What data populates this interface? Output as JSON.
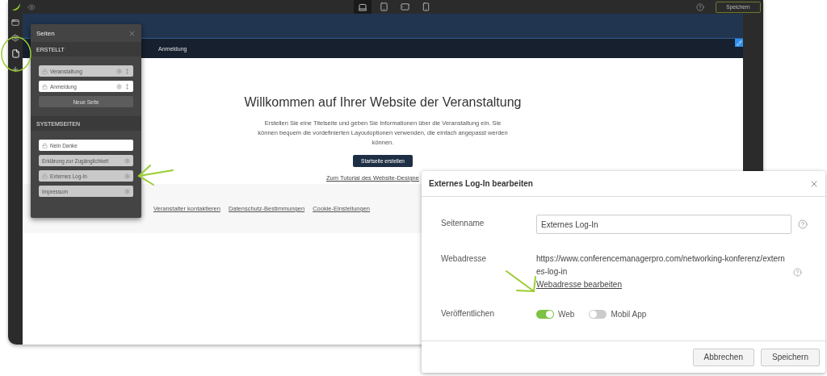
{
  "top_bar": {
    "devices": [
      {
        "kind": "laptop",
        "selected": true
      },
      {
        "kind": "tablet",
        "selected": false
      },
      {
        "kind": "tablet-landscape",
        "selected": false
      },
      {
        "kind": "phone",
        "selected": false
      }
    ],
    "save_button": "Speichern"
  },
  "site_nav": {
    "items": [
      "Anmeldung"
    ]
  },
  "welcome": {
    "title": "Willkommen auf Ihrer Website der Veranstaltung",
    "text": "Erstellen Sie eine Titelseite und geben Sie Informationen über die Veranstaltung ein. Sie können bequem die vordefinierten Layoutoptionen verwenden, die einfach angepasst werden können.",
    "button": "Startseite erstellen",
    "tutorial_link": "Zum Tutorial des Website-Designe"
  },
  "footer_links": [
    "Veranstalter kontaktieren",
    "Datenschutz-Bestimmungen",
    "Cookie-Einstellungen"
  ],
  "pages_panel": {
    "title": "Seiten",
    "sections": [
      {
        "heading": "ERSTELLT",
        "pages": [
          {
            "label": "Veranstaltung",
            "active": false,
            "locked": true,
            "settings": true,
            "movable": true
          },
          {
            "label": "Anmeldung",
            "active": true,
            "locked": true,
            "settings": true,
            "movable": true
          }
        ],
        "new_page_button": "Neue Seite"
      },
      {
        "heading": "SYSTEMSEITEN",
        "pages": [
          {
            "label": "Nein Danke",
            "active": true,
            "locked": true,
            "settings": false,
            "movable": false
          },
          {
            "label": "Erklärung zur Zugänglichkeit",
            "active": false,
            "locked": false,
            "settings": true,
            "movable": false
          },
          {
            "label": "Externes Log-In",
            "active": false,
            "locked": true,
            "settings": true,
            "movable": false
          },
          {
            "label": "Impressum",
            "active": false,
            "locked": false,
            "settings": true,
            "movable": false
          }
        ]
      }
    ]
  },
  "dialog": {
    "title": "Externes Log-In bearbeiten",
    "page_name": {
      "label": "Seitenname",
      "value": "Externes Log-In"
    },
    "web_address": {
      "label": "Webadresse",
      "url": "https://www.conferencemanagerpro.com/networking-konferenz/externes-log-in",
      "edit_link": "Webadresse bearbeiten"
    },
    "publish": {
      "label": "Veröffentlichen",
      "options": [
        {
          "label": "Web",
          "on": true
        },
        {
          "label": "Mobil App",
          "on": false
        }
      ]
    },
    "buttons": [
      "Abbrechen",
      "Speichern"
    ]
  }
}
